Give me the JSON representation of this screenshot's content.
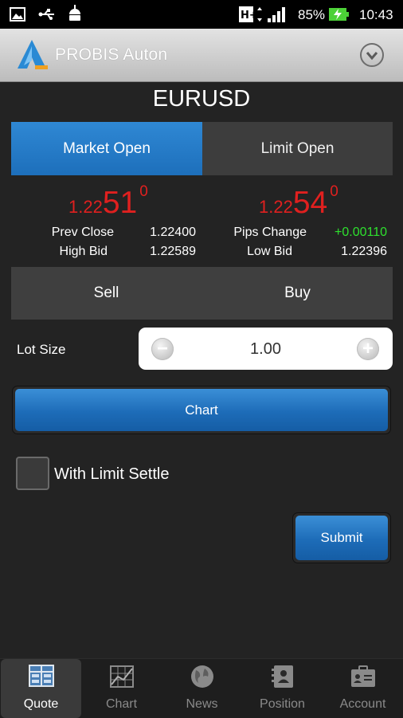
{
  "status_bar": {
    "battery": "85%",
    "time": "10:43",
    "icons": [
      "image-icon",
      "usb-icon",
      "android-icon",
      "hplus-signal-icon",
      "battery-charging-icon"
    ]
  },
  "app": {
    "title": "PROBIS Auton",
    "logo_icon": "probis-logo-icon",
    "menu_icon": "chevron-down-circle-icon"
  },
  "symbol": "EURUSD",
  "tabs": [
    {
      "label": "Market Open",
      "active": true
    },
    {
      "label": "Limit Open",
      "active": false
    }
  ],
  "prices": {
    "sell": {
      "small": "1.22",
      "big": "51",
      "sup": "0"
    },
    "buy": {
      "small": "1.22",
      "big": "54",
      "sup": "0"
    }
  },
  "stats": {
    "prev_close_label": "Prev Close",
    "prev_close": "1.22400",
    "high_bid_label": "High Bid",
    "high_bid": "1.22589",
    "pips_change_label": "Pips Change",
    "pips_change": "+0.00110",
    "low_bid_label": "Low Bid",
    "low_bid": "1.22396"
  },
  "actions": {
    "sell": "Sell",
    "buy": "Buy"
  },
  "lot": {
    "label": "Lot Size",
    "value": "1.00"
  },
  "chart_button": "Chart",
  "limit_settle": {
    "label": "With Limit Settle",
    "checked": false
  },
  "submit": "Submit",
  "nav": [
    {
      "label": "Quote",
      "icon": "quote-icon",
      "active": true
    },
    {
      "label": "Chart",
      "icon": "chart-icon",
      "active": false
    },
    {
      "label": "News",
      "icon": "globe-icon",
      "active": false
    },
    {
      "label": "Position",
      "icon": "position-icon",
      "active": false
    },
    {
      "label": "Account",
      "icon": "account-icon",
      "active": false
    }
  ],
  "colors": {
    "accent": "#2a7fcc",
    "price_red": "#e0201f",
    "pips_green": "#2ee02e",
    "background": "#232323"
  }
}
